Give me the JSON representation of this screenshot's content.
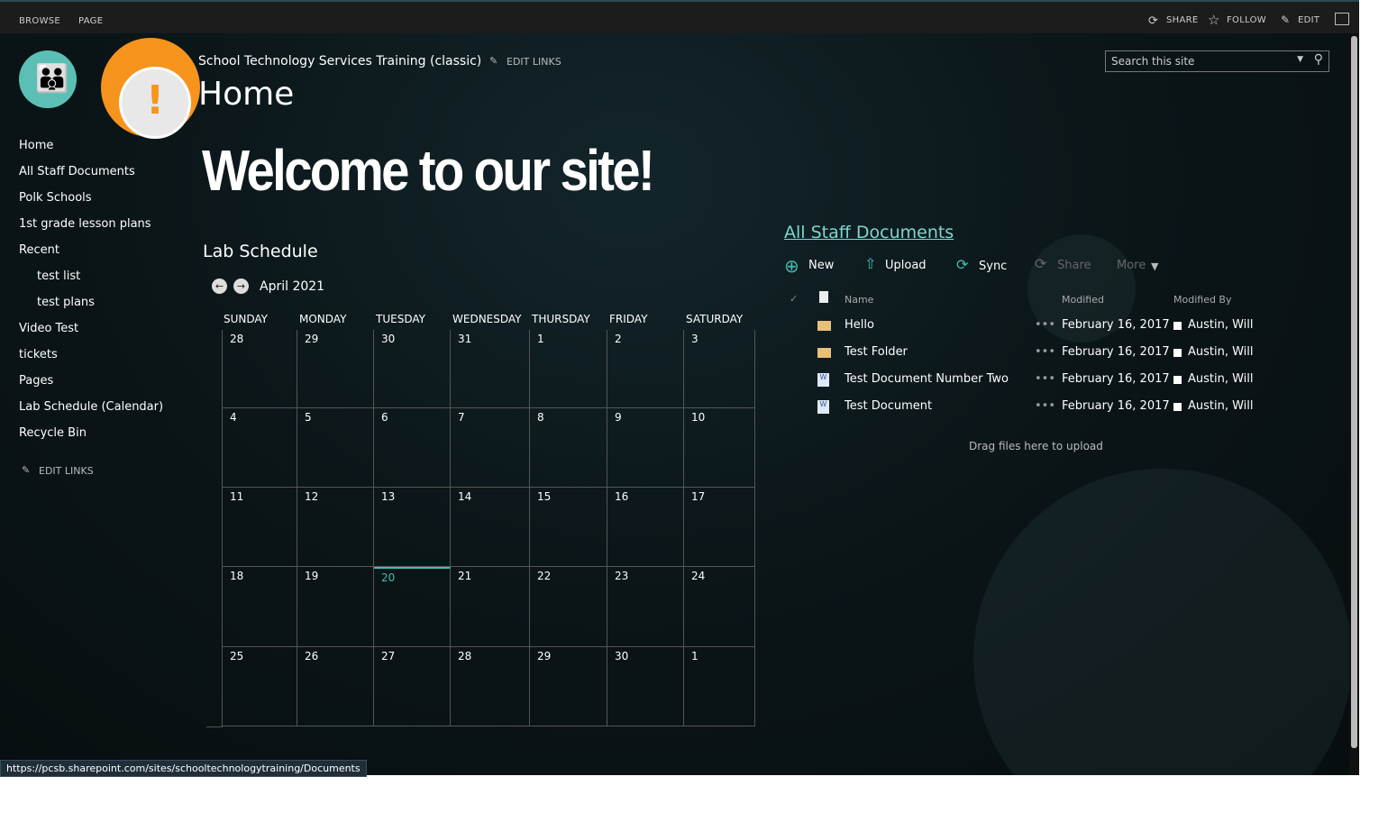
{
  "topbar": {
    "browse": "BROWSE",
    "page": "PAGE",
    "share": "SHARE",
    "follow": "FOLLOW",
    "edit": "EDIT"
  },
  "header": {
    "site_title": "School Technology Services Training (classic)",
    "edit_links": "EDIT LINKS",
    "page_title": "Home",
    "search_placeholder": "Search this site"
  },
  "welcome": "Welcome to our site!",
  "sidebar": {
    "items": [
      {
        "label": "Home"
      },
      {
        "label": "All Staff Documents"
      },
      {
        "label": "Polk Schools"
      },
      {
        "label": "1st grade lesson plans"
      },
      {
        "label": "Recent"
      },
      {
        "label": "test list"
      },
      {
        "label": "test plans"
      },
      {
        "label": "Video Test"
      },
      {
        "label": "tickets"
      },
      {
        "label": "Pages"
      },
      {
        "label": "Lab Schedule (Calendar)"
      },
      {
        "label": "Recycle Bin"
      }
    ],
    "edit_links": "EDIT LINKS"
  },
  "calendar": {
    "title": "Lab Schedule",
    "month": "April 2021",
    "days": [
      "SUNDAY",
      "MONDAY",
      "TUESDAY",
      "WEDNESDAY",
      "THURSDAY",
      "FRIDAY",
      "SATURDAY"
    ],
    "weeks": [
      [
        "28",
        "29",
        "30",
        "31",
        "1",
        "2",
        "3"
      ],
      [
        "4",
        "5",
        "6",
        "7",
        "8",
        "9",
        "10"
      ],
      [
        "11",
        "12",
        "13",
        "14",
        "15",
        "16",
        "17"
      ],
      [
        "18",
        "19",
        "20",
        "21",
        "22",
        "23",
        "24"
      ],
      [
        "25",
        "26",
        "27",
        "28",
        "29",
        "30",
        "1"
      ]
    ],
    "today": "20"
  },
  "docs": {
    "title": "All Staff Documents",
    "commands": {
      "new": "New",
      "upload": "Upload",
      "sync": "Sync",
      "share": "Share",
      "more": "More"
    },
    "columns": {
      "name": "Name",
      "modified": "Modified",
      "modified_by": "Modified By"
    },
    "rows": [
      {
        "name": "Hello",
        "type": "folder",
        "modified": "February 16, 2017",
        "by": "Austin, Will"
      },
      {
        "name": "Test Folder",
        "type": "folder",
        "modified": "February 16, 2017",
        "by": "Austin, Will"
      },
      {
        "name": "Test Document Number Two",
        "type": "word",
        "modified": "February 16, 2017",
        "by": "Austin, Will"
      },
      {
        "name": "Test Document",
        "type": "word",
        "modified": "February 16, 2017",
        "by": "Austin, Will"
      }
    ],
    "drag_hint": "Drag files here to upload"
  },
  "status_url": "https://pcsb.sharepoint.com/sites/schooltechnologytraining/Documents",
  "colors": {
    "accent": "#3fbfb0",
    "link": "#7fd6cf",
    "warning": "#f7941d"
  }
}
